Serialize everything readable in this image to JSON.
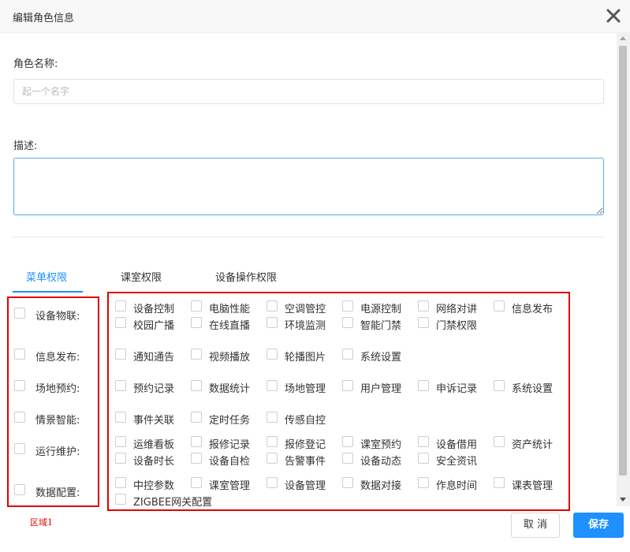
{
  "dialog": {
    "title": "编辑角色信息"
  },
  "form": {
    "role_name_label": "角色名称:",
    "role_name_placeholder": "起一个名字",
    "role_name_value": "",
    "desc_label": "描述:",
    "desc_value": ""
  },
  "tabs": [
    {
      "label": "菜单权限",
      "active": true
    },
    {
      "label": "课室权限",
      "active": false
    },
    {
      "label": "设备操作权限",
      "active": false
    }
  ],
  "categories": [
    {
      "label": "设备物联:",
      "items": [
        [
          "设备控制",
          "电脑性能",
          "空调管控",
          "电源控制",
          "网络对讲",
          "信息发布"
        ],
        [
          "校园广播",
          "在线直播",
          "环境监测",
          "智能门禁",
          "门禁权限"
        ]
      ]
    },
    {
      "label": "信息发布:",
      "items": [
        [
          "通知通告",
          "视频播放",
          "轮播图片",
          "系统设置"
        ]
      ]
    },
    {
      "label": "场地预约:",
      "items": [
        [
          "预约记录",
          "数据统计",
          "场地管理",
          "用户管理",
          "申诉记录",
          "系统设置"
        ]
      ]
    },
    {
      "label": "情景智能:",
      "items": [
        [
          "事件关联",
          "定时任务",
          "传感自控"
        ]
      ]
    },
    {
      "label": "运行维护:",
      "items": [
        [
          "运维看板",
          "报修记录",
          "报修登记",
          "课室预约",
          "设备借用",
          "资产统计"
        ],
        [
          "设备时长",
          "设备自检",
          "告警事件",
          "设备动态",
          "安全资讯"
        ]
      ]
    },
    {
      "label": "数据配置:",
      "items": [
        [
          "中控参数",
          "课室管理",
          "设备管理",
          "数据对接",
          "作息时间",
          "课表管理"
        ],
        [
          "ZIGBEE网关配置"
        ]
      ]
    }
  ],
  "annotation": {
    "area_label": "区域1",
    "color": "#e00000"
  },
  "buttons": {
    "cancel": "取 消",
    "save": "保存"
  },
  "colors": {
    "accent": "#1e90ff",
    "highlight_box": "#e00000"
  }
}
